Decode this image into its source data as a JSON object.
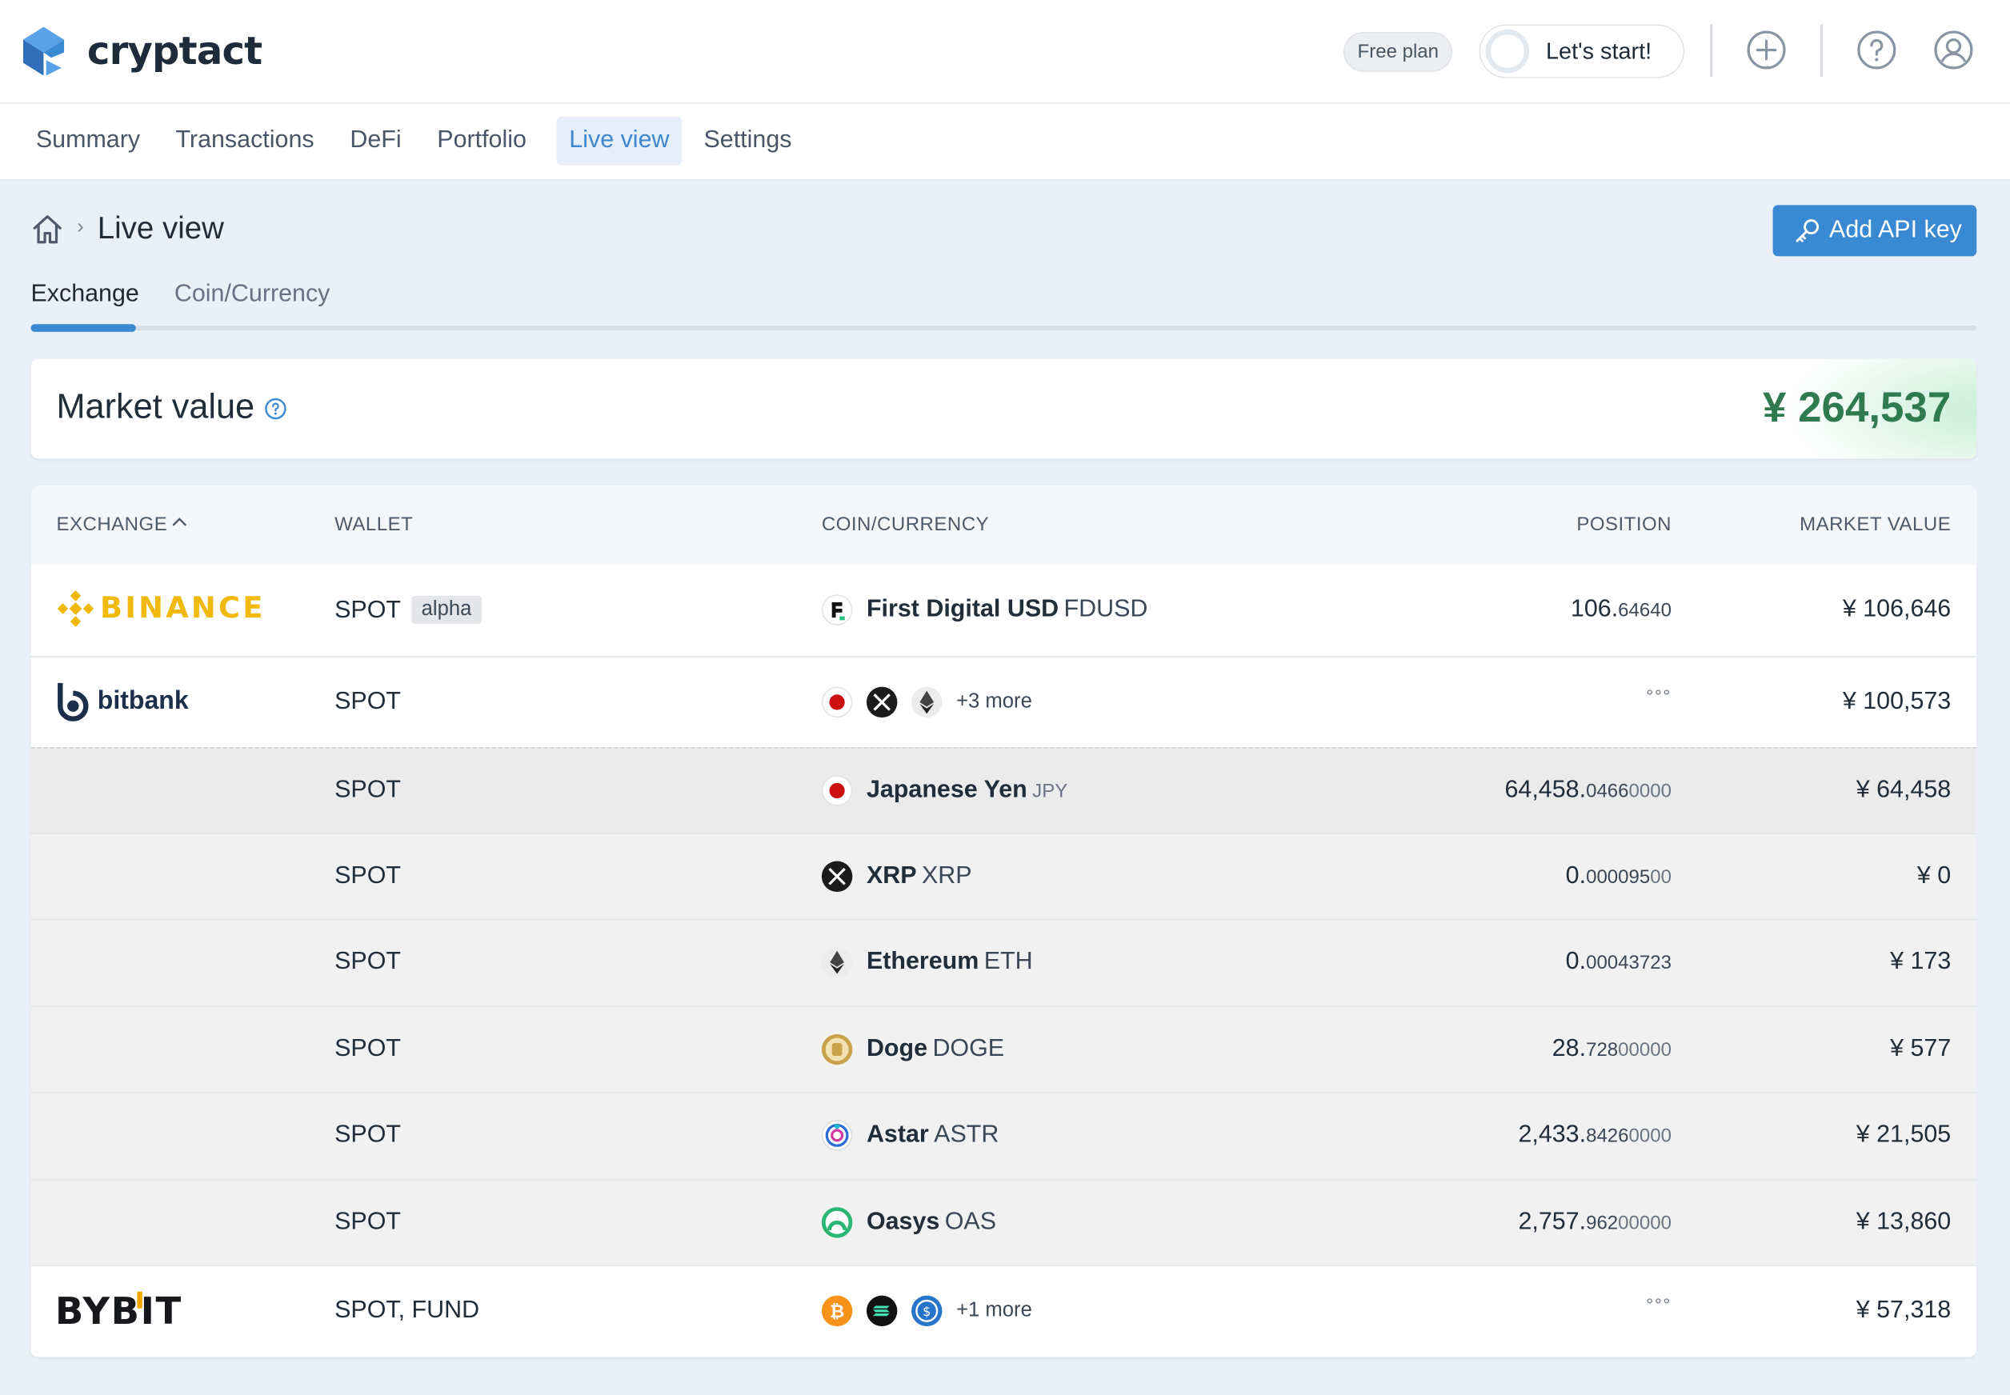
{
  "brand": {
    "name": "cryptact",
    "accent": "#3a89d3"
  },
  "header": {
    "plan_badge": "Free plan",
    "start_label": "Let's start!"
  },
  "nav": [
    "Summary",
    "Transactions",
    "DeFi",
    "Portfolio",
    "Live view",
    "Settings"
  ],
  "nav_active": "Live view",
  "breadcrumb": {
    "current": "Live view",
    "separator": "›"
  },
  "actions": {
    "add_api_key": "Add API key"
  },
  "tabs": {
    "exchange": "Exchange",
    "coin_currency": "Coin/Currency",
    "active": "Exchange"
  },
  "market_value": {
    "label": "Market value",
    "value": "¥ 264,537"
  },
  "table": {
    "headers": {
      "exchange": "EXCHANGE",
      "wallet": "WALLET",
      "coin": "COIN/CURRENCY",
      "position": "POSITION",
      "market_value": "MARKET VALUE"
    },
    "rows": [
      {
        "exchange": "BINANCE",
        "wallet": "SPOT",
        "wallet_badge": "alpha",
        "coin_name": "First Digital USD",
        "coin_symbol": "FDUSD",
        "position_int": "106.",
        "position_dec": "64640",
        "position_faint": "",
        "market_value": "¥ 106,646"
      },
      {
        "exchange": "bitbank",
        "wallet": "SPOT",
        "more": "+3 more",
        "position_placeholder": "°°°",
        "market_value": "¥ 100,573"
      },
      {
        "wallet": "SPOT",
        "coin_name": "Japanese Yen",
        "coin_symbol": "JPY",
        "position_int": "64,458.",
        "position_dec": "0466",
        "position_faint": "0000",
        "market_value": "¥ 64,458"
      },
      {
        "wallet": "SPOT",
        "coin_name": "XRP",
        "coin_symbol": "XRP",
        "position_int": "0.",
        "position_dec": "000095",
        "position_faint": "00",
        "market_value": "¥ 0"
      },
      {
        "wallet": "SPOT",
        "coin_name": "Ethereum",
        "coin_symbol": "ETH",
        "position_int": "0.",
        "position_dec": "00043723",
        "position_faint": "",
        "market_value": "¥ 173"
      },
      {
        "wallet": "SPOT",
        "coin_name": "Doge",
        "coin_symbol": "DOGE",
        "position_int": "28.",
        "position_dec": "728",
        "position_faint": "00000",
        "market_value": "¥ 577"
      },
      {
        "wallet": "SPOT",
        "coin_name": "Astar",
        "coin_symbol": "ASTR",
        "position_int": "2,433.",
        "position_dec": "8426",
        "position_faint": "0000",
        "market_value": "¥ 21,505"
      },
      {
        "wallet": "SPOT",
        "coin_name": "Oasys",
        "coin_symbol": "OAS",
        "position_int": "2,757.",
        "position_dec": "962",
        "position_faint": "00000",
        "market_value": "¥ 13,860"
      },
      {
        "exchange": "BYBIT",
        "wallet": "SPOT, FUND",
        "more": "+1 more",
        "position_placeholder": "°°°",
        "market_value": "¥ 57,318"
      }
    ]
  },
  "colors": {
    "market_value_green": "#2f7a4f",
    "binance_gold": "#f0b90b",
    "bitbank_navy": "#1b2f4a"
  },
  "icons": [
    "cryptact-logo-icon",
    "add-circle-icon",
    "help-circle-icon",
    "user-circle-icon",
    "home-icon",
    "key-icon",
    "question-icon",
    "sort-up-icon"
  ]
}
